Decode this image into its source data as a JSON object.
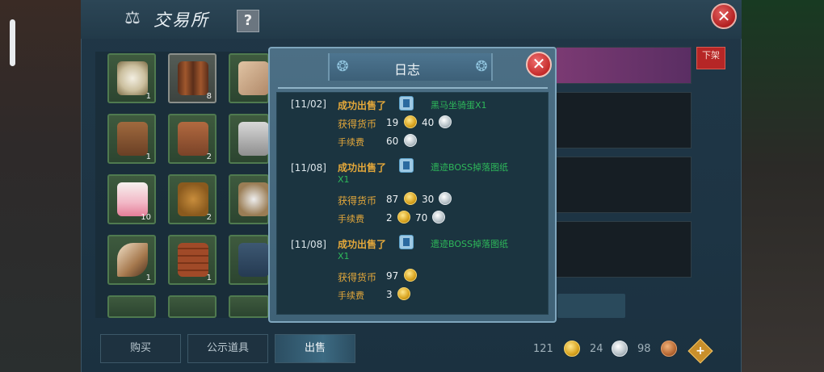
{
  "window": {
    "title": "交易所",
    "help_label": "?",
    "close_label": "✕"
  },
  "grid": {
    "slots": [
      {
        "count": "1"
      },
      {
        "count": "8"
      },
      {
        "count": ""
      },
      {
        "count": "1"
      },
      {
        "count": "2"
      },
      {
        "count": ""
      },
      {
        "count": "10"
      },
      {
        "count": "2"
      },
      {
        "count": ""
      },
      {
        "count": "1"
      },
      {
        "count": "1"
      },
      {
        "count": ""
      }
    ]
  },
  "right_panel": {
    "unshelf_label": "下架"
  },
  "tabs": [
    {
      "label": "购买"
    },
    {
      "label": "公示道具"
    },
    {
      "label": "出售"
    }
  ],
  "currency": {
    "gold": "121",
    "silver": "24",
    "copper": "98",
    "add_label": "+"
  },
  "log": {
    "title": "日志",
    "close_label": "✕",
    "entries": [
      {
        "date": "[11/02]",
        "action": "成功出售了",
        "item": "黑马坐骑蛋X1",
        "earned_label": "获得货币",
        "earned_gold": "19",
        "earned_silver": "40",
        "fee_label": "手续费",
        "fee_gold": "",
        "fee_silver": "60"
      },
      {
        "date": "[11/08]",
        "action": "成功出售了",
        "item": "遗迹BOSS掉落图纸",
        "item_line2": "X1",
        "earned_label": "获得货币",
        "earned_gold": "87",
        "earned_silver": "30",
        "fee_label": "手续费",
        "fee_gold": "2",
        "fee_silver": "70"
      },
      {
        "date": "[11/08]",
        "action": "成功出售了",
        "item": "遗迹BOSS掉落图纸",
        "item_line2": "X1",
        "earned_label": "获得货币",
        "earned_gold": "97",
        "earned_silver": "",
        "fee_label": "手续费",
        "fee_gold": "3",
        "fee_silver": ""
      }
    ]
  },
  "colors": {
    "accent_gold": "#e4a83a",
    "item_green": "#2eb85a",
    "close_red": "#c42a2a"
  }
}
